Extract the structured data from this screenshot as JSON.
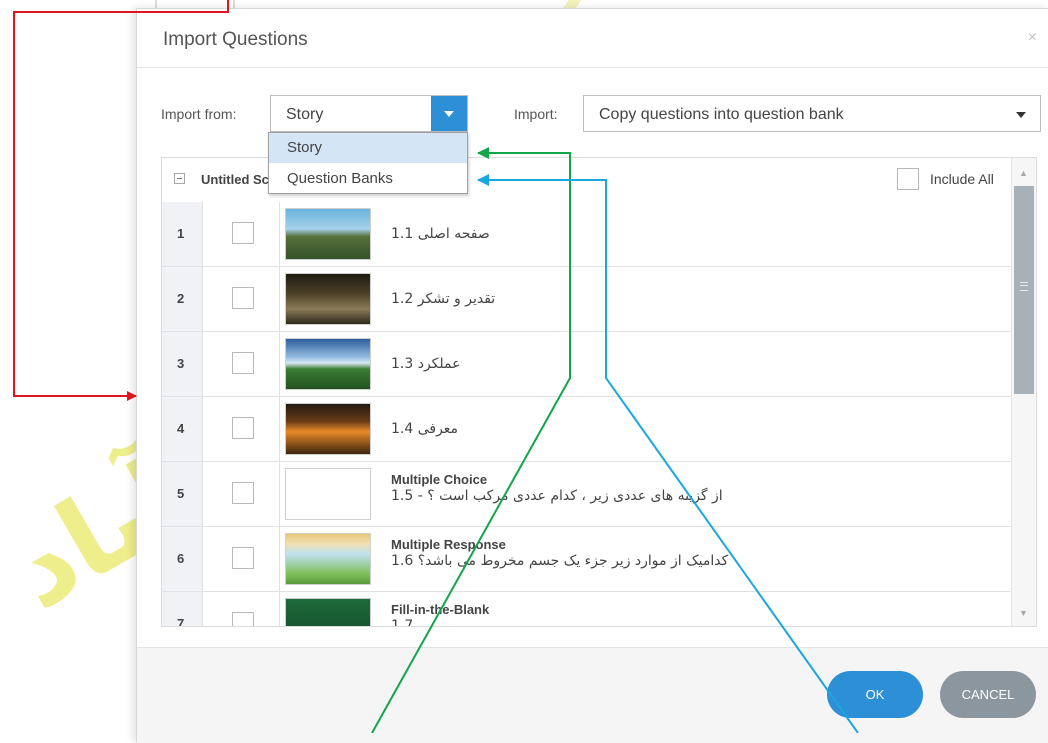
{
  "dialog": {
    "title": "Import Questions",
    "close_glyph": "×",
    "import_from_label": "Import from:",
    "import_from_value": "Story",
    "import_label": "Import:",
    "import_value": "Copy questions into question bank",
    "scene_name": "Untitled Sc",
    "include_all_label": "Include All",
    "ok_label": "OK",
    "cancel_label": "CANCEL"
  },
  "dropdown": {
    "options": [
      "Story",
      "Question Banks"
    ],
    "selected": "Story"
  },
  "rows": [
    {
      "num": "1",
      "title": "",
      "text": "صفحه اصلی 1.1"
    },
    {
      "num": "2",
      "title": "",
      "text": "تقدیر و تشکر 1.2"
    },
    {
      "num": "3",
      "title": "",
      "text": "عملکرد 1.3"
    },
    {
      "num": "4",
      "title": "",
      "text": "معرفی 1.4"
    },
    {
      "num": "5",
      "title": "Multiple Choice",
      "text": "از گزینه های عددی زیر ، کدام عددی مرکب است ؟ - 1.5"
    },
    {
      "num": "6",
      "title": "Multiple Response",
      "text": "کدامیک از موارد زیر جزء یک جسم مخروط می باشد؟ 1.6"
    },
    {
      "num": "7",
      "title": "Fill-in-the-Blank",
      "text": "1.7"
    }
  ],
  "colors": {
    "accent": "#2d8fd5",
    "cancel": "#8b969e",
    "annotation_red": "#e0141e",
    "annotation_green": "#12a54a",
    "annotation_blue": "#1aa7e0"
  },
  "icons": [
    "close-icon",
    "dropdown-caret-icon",
    "collapse-icon",
    "scroll-up-icon",
    "scroll-down-icon"
  ]
}
